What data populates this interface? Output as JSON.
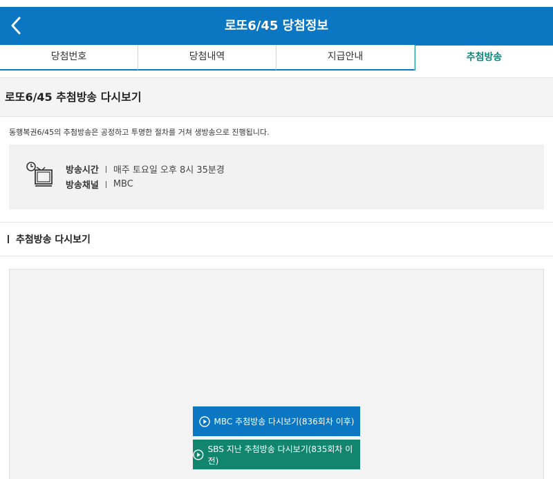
{
  "header": {
    "title": "로또6/45 당첨정보",
    "back_icon": "chevron-left-icon"
  },
  "tabs": [
    {
      "label": "당첨번호",
      "active": false
    },
    {
      "label": "당첨내역",
      "active": false
    },
    {
      "label": "지급안내",
      "active": false
    },
    {
      "label": "추첨방송",
      "active": true
    }
  ],
  "page": {
    "title": "로또6/45 추첨방송 다시보기",
    "description": "동행복권6/45의 추첨방송은 공정하고 투명한 절차를 거쳐 생방송으로 진행됩니다."
  },
  "broadcast_info": {
    "icon": "tv-clock-icon",
    "time_label": "방송시간",
    "time_value": "매주 토요일 오후 8시 35분경",
    "channel_label": "방송채널",
    "channel_value": "MBC"
  },
  "replay": {
    "heading": "추첨방송 다시보기",
    "mbc_button": "MBC 추첨방송 다시보기(836회차 이후)",
    "sbs_button": "SBS 지난 추첨방송 다시보기(835회차 이전)",
    "play_icon": "play-circle-icon"
  },
  "colors": {
    "header_bg": "#0b77c2",
    "active_tab": "#0a8a7e",
    "mbc_button_bg": "#0b77c2",
    "sbs_button_bg": "#12856e"
  }
}
